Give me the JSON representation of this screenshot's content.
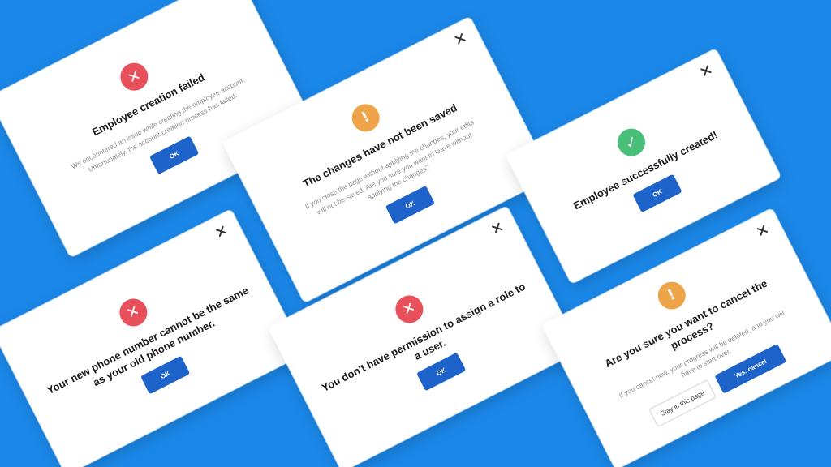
{
  "colors": {
    "background": "#1b88e9",
    "error": "#e8505b",
    "warning": "#f0a44a",
    "success": "#48c07a",
    "primary_button": "#1e63c9"
  },
  "dialogs": {
    "employee_failed": {
      "icon": "error-x-icon",
      "icon_glyph": "✕",
      "title": "Employee creation failed",
      "description": "We encountered an issue while creating the employee account. Unfortunately, the account creation process has failed.",
      "ok_label": "OK"
    },
    "changes_not_saved": {
      "icon": "warning-icon",
      "icon_glyph": "!",
      "title": "The changes have not been saved",
      "description": "If you close the page without applying the changes, your edits will not be saved. Are you sure you want to leave without applying the changes?",
      "ok_label": "OK"
    },
    "employee_created": {
      "icon": "checkmark-icon",
      "icon_glyph": "✓",
      "title": "Employee  successfully created!",
      "ok_label": "OK"
    },
    "phone_same": {
      "icon": "error-x-icon",
      "icon_glyph": "✕",
      "title": "Your new phone number cannot be the same as your old phone number.",
      "ok_label": "OK"
    },
    "no_permission": {
      "icon": "error-x-icon",
      "icon_glyph": "✕",
      "title": "You don't have permission to assign a role to a user.",
      "ok_label": "OK"
    },
    "cancel_process": {
      "icon": "warning-icon",
      "icon_glyph": "!",
      "title": "Are you sure you want to cancel the process?",
      "description": "If you cancel now, your progress will be deleted, and you will have to start over.",
      "stay_label": "Stay in this page",
      "confirm_label": "Yes, cancel"
    }
  }
}
